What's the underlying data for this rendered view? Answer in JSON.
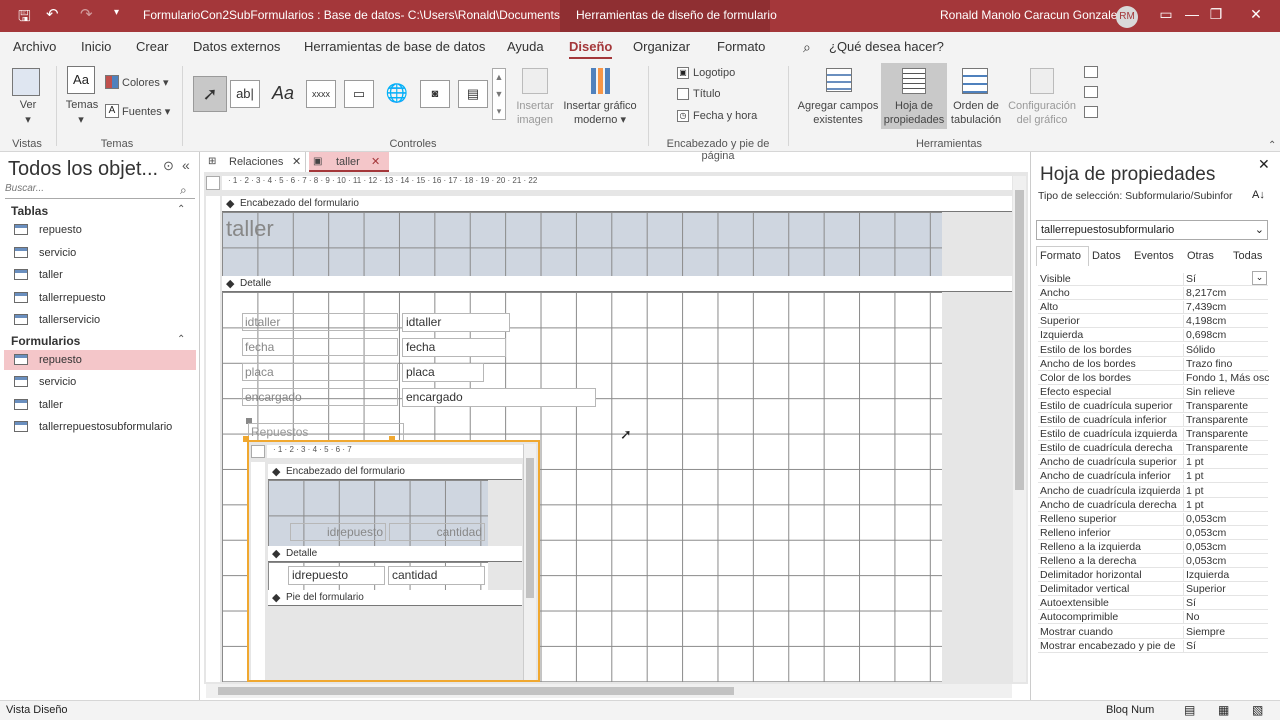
{
  "titlebar": {
    "doc_title": "FormularioCon2SubFormularios : Base de datos- C:\\Users\\Ronald\\Documents\\...",
    "context_tab": "Herramientas de diseño de formulario",
    "user_name": "Ronald Manolo Caracun Gonzalez",
    "user_initials": "RM"
  },
  "menu": {
    "items": [
      "Archivo",
      "Inicio",
      "Crear",
      "Datos externos",
      "Herramientas de base de datos",
      "Ayuda",
      "Diseño",
      "Organizar",
      "Formato"
    ],
    "search": "¿Qué desea hacer?",
    "active": "Diseño"
  },
  "ribbon": {
    "ver": "Ver",
    "temas": "Temas",
    "colores": "Colores",
    "fuentes": "Fuentes",
    "insertar_imagen": "Insertar imagen",
    "insertar_grafico": "Insertar gráfico moderno",
    "logotipo": "Logotipo",
    "titulo": "Título",
    "fecha_hora": "Fecha y hora",
    "agregar_campos": "Agregar campos existentes",
    "hoja_propiedades": "Hoja de propiedades",
    "orden_tabulacion": "Orden de tabulación",
    "config_grafico": "Configuración del gráfico",
    "groups": {
      "vistas": "Vistas",
      "temas": "Temas",
      "controles": "Controles",
      "encabezado": "Encabezado y pie de página",
      "herramientas": "Herramientas"
    }
  },
  "nav": {
    "title": "Todos los objet...",
    "search_placeholder": "Buscar...",
    "tables_header": "Tablas",
    "tables": [
      "repuesto",
      "servicio",
      "taller",
      "tallerrepuesto",
      "tallerservicio"
    ],
    "forms_header": "Formularios",
    "forms": [
      "repuesto",
      "servicio",
      "taller",
      "tallerrepuestosubformulario"
    ],
    "selected_form": "repuesto"
  },
  "doc_tabs": {
    "relaciones": "Relaciones",
    "taller": "taller"
  },
  "design": {
    "header_bar": "Encabezado del formulario",
    "form_title": "taller",
    "detail_bar": "Detalle",
    "labels": [
      "idtaller",
      "fecha",
      "placa",
      "encargado"
    ],
    "fields": [
      "idtaller",
      "fecha",
      "placa",
      "encargado"
    ],
    "subform_label": "Repuestos",
    "subform": {
      "header_bar": "Encabezado del formulario",
      "header_labels": [
        "idrepuesto",
        "cantidad"
      ],
      "detail_bar": "Detalle",
      "fields": [
        "idrepuesto",
        "cantidad"
      ],
      "footer_bar": "Pie del formulario"
    },
    "ruler_main": "· 1 · 2 · 3 · 4 · 5 · 6 · 7 · 8 · 9 · 10 · 11 · 12 · 13 · 14 · 15 · 16 · 17 · 18 · 19 · 20 · 21 · 22",
    "ruler_sub": "· 1 · 2 · 3 · 4 · 5 · 6 · 7"
  },
  "props": {
    "title": "Hoja de propiedades",
    "selection_type": "Tipo de selección:  Subformulario/Subinfor",
    "object": "tallerrepuestosubformulario",
    "tabs": [
      "Formato",
      "Datos",
      "Eventos",
      "Otras",
      "Todas"
    ],
    "rows": [
      [
        "Visible",
        "Sí"
      ],
      [
        "Ancho",
        "8,217cm"
      ],
      [
        "Alto",
        "7,439cm"
      ],
      [
        "Superior",
        "4,198cm"
      ],
      [
        "Izquierda",
        "0,698cm"
      ],
      [
        "Estilo de los bordes",
        "Sólido"
      ],
      [
        "Ancho de los bordes",
        "Trazo fino"
      ],
      [
        "Color de los bordes",
        "Fondo 1, Más osc"
      ],
      [
        "Efecto especial",
        "Sin relieve"
      ],
      [
        "Estilo de cuadrícula superior",
        "Transparente"
      ],
      [
        "Estilo de cuadrícula inferior",
        "Transparente"
      ],
      [
        "Estilo de cuadrícula izquierda",
        "Transparente"
      ],
      [
        "Estilo de cuadrícula derecha",
        "Transparente"
      ],
      [
        "Ancho de cuadrícula superior",
        "1 pt"
      ],
      [
        "Ancho de cuadrícula inferior",
        "1 pt"
      ],
      [
        "Ancho de cuadrícula izquierda",
        "1 pt"
      ],
      [
        "Ancho de cuadrícula derecha",
        "1 pt"
      ],
      [
        "Relleno superior",
        "0,053cm"
      ],
      [
        "Relleno inferior",
        "0,053cm"
      ],
      [
        "Relleno a la izquierda",
        "0,053cm"
      ],
      [
        "Relleno a la derecha",
        "0,053cm"
      ],
      [
        "Delimitador horizontal",
        "Izquierda"
      ],
      [
        "Delimitador vertical",
        "Superior"
      ],
      [
        "Autoextensible",
        "Sí"
      ],
      [
        "Autocomprimible",
        "No"
      ],
      [
        "Mostrar cuando",
        "Siempre"
      ],
      [
        "Mostrar encabezado y pie de",
        "Sí"
      ]
    ]
  },
  "status": {
    "left": "Vista Diseño",
    "caps": "Bloq Num"
  },
  "colors": {
    "accent": "#a4373a",
    "selected": "#f4c6c9",
    "header_section": "#cfd6e0"
  }
}
